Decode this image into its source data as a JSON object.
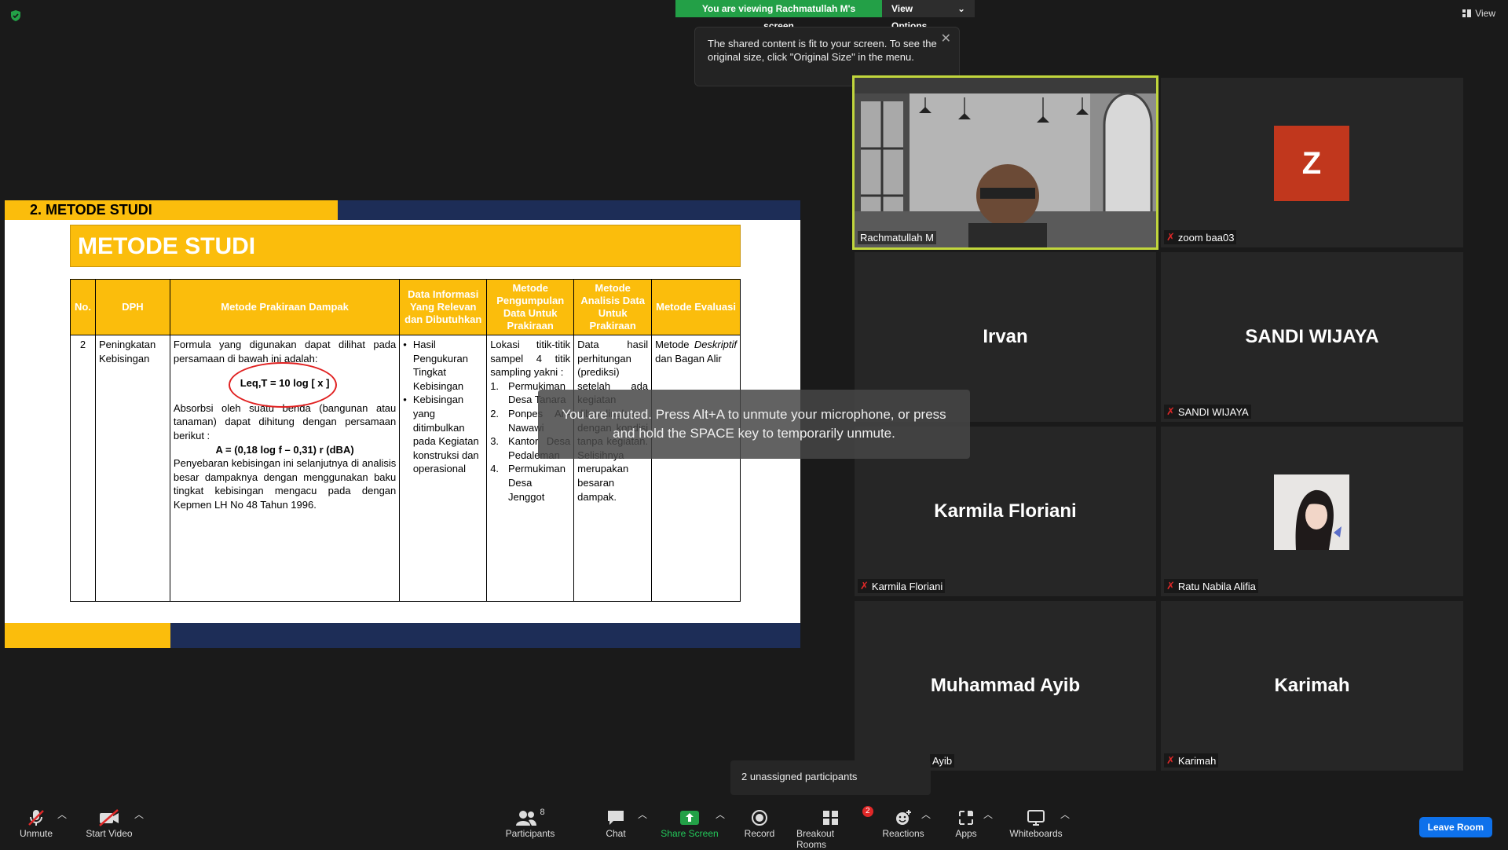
{
  "banner": {
    "viewing": "You are viewing Rachmatullah M's screen",
    "view_options": "View Options"
  },
  "tooltip": {
    "text": "The shared content is fit to your screen. To see the original size, click \"Original Size\" in the menu."
  },
  "view": {
    "label": "View"
  },
  "slide": {
    "header": "2. METODE STUDI",
    "title": "METODE STUDI",
    "columns": [
      "No.",
      "DPH",
      "Metode Prakiraan Dampak",
      "Data Informasi Yang Relevan dan Dibutuhkan",
      "Metode Pengumpulan Data Untuk Prakiraan",
      "Metode Analisis Data Untuk Prakiraan",
      "Metode Evaluasi"
    ],
    "row": {
      "no": "2",
      "dph": "Peningkatan Kebisingan",
      "prakiraan_intro": "Formula yang digunakan dapat dilihat pada persamaan di bawah ini adalah:",
      "formula1": "Leq,T = 10 log [ x ]",
      "absorbsi": "Absorbsi oleh suatu benda (bangunan atau tanaman) dapat dihitung dengan persamaan berikut :",
      "formula2": "A = (0,18 log f – 0,31) r (dBA)",
      "penyebaran": "Penyebaran kebisingan ini selanjutnya di analisis besar dampaknya dengan menggunakan baku tingkat kebisingan mengacu pada dengan Kepmen LH No 48 Tahun 1996.",
      "data_info": [
        "Hasil Pengukuran Tingkat Kebisingan",
        "Kebisingan yang ditimbulkan pada Kegiatan konstruksi dan operasional"
      ],
      "pengumpulan_intro": "Lokasi titik-titik sampel 4 titik sampling yakni :",
      "pengumpulan": [
        "Permukiman Desa Tanara",
        "Ponpes An-Nawawi",
        "Kantor Desa Pedaleman",
        "Permukiman Desa Jenggot"
      ],
      "analisis": "Data hasil perhitungan (prediksi) setelah ada kegiatan dibandingkan dengan kondisi tanpa kegiatan. Selisihnya merupakan besaran dampak.",
      "evaluasi_a": "Metode",
      "evaluasi_b": "Deskriptif",
      "evaluasi_c": "dan Bagan Alir"
    }
  },
  "participants_tiles": [
    {
      "display": "",
      "label": "Rachmatullah M"
    },
    {
      "display": "Z",
      "label": "zoom baa03"
    },
    {
      "display": "Irvan",
      "label": ""
    },
    {
      "display": "SANDI WIJAYA",
      "label": "SANDI WIJAYA"
    },
    {
      "display": "Karmila Floriani",
      "label": "Karmila Floriani"
    },
    {
      "display": "",
      "label": "Ratu Nabila Alifia"
    },
    {
      "display": "Muhammad Ayib",
      "label": "Ayib"
    },
    {
      "display": "Karimah",
      "label": "Karimah"
    }
  ],
  "muted_toast": "You are muted. Press Alt+A to unmute your microphone, or press and hold the SPACE key to temporarily unmute.",
  "unassigned": "2 unassigned participants",
  "toolbar": {
    "unmute": "Unmute",
    "start_video": "Start Video",
    "participants": "Participants",
    "participants_count": "8",
    "chat": "Chat",
    "share_screen": "Share Screen",
    "record": "Record",
    "breakout_rooms": "Breakout Rooms",
    "breakout_badge": "2",
    "reactions": "Reactions",
    "apps": "Apps",
    "whiteboards": "Whiteboards",
    "leave_room": "Leave Room"
  },
  "colors": {
    "green": "#23a047",
    "slide_yellow": "#fbbd0c",
    "slide_navy": "#1d2d57",
    "speaker_border": "#c1d63c",
    "leave_blue": "#0e71eb",
    "mic_red": "#e02828"
  }
}
